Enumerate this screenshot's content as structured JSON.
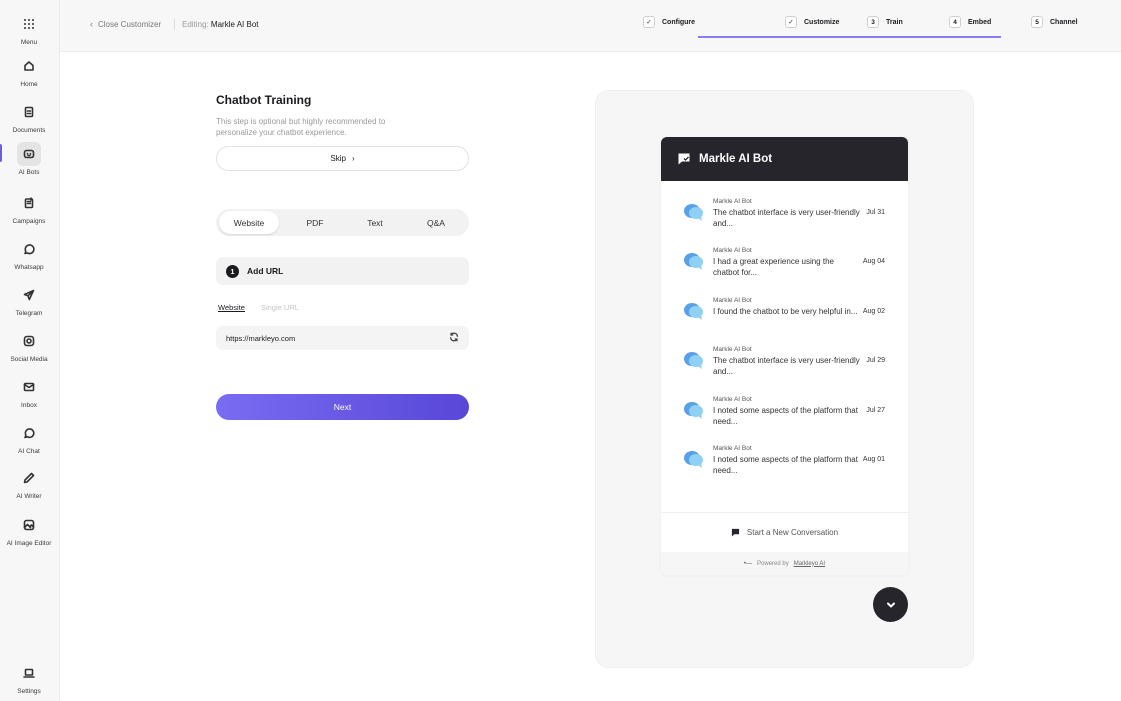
{
  "sidebar": {
    "items": [
      {
        "label": "Menu",
        "icon": "grid-icon"
      },
      {
        "label": "Home",
        "icon": "home-icon"
      },
      {
        "label": "Documents",
        "icon": "document-icon"
      },
      {
        "label": "AI Bots",
        "icon": "bot-icon"
      },
      {
        "label": "Campaigns",
        "icon": "campaign-icon"
      },
      {
        "label": "Whatsapp",
        "icon": "whatsapp-icon"
      },
      {
        "label": "Telegram",
        "icon": "telegram-icon"
      },
      {
        "label": "Social Media",
        "icon": "instagram-icon"
      },
      {
        "label": "Inbox",
        "icon": "mail-icon"
      },
      {
        "label": "AI Chat",
        "icon": "chat-icon"
      },
      {
        "label": "AI Writer",
        "icon": "pen-icon"
      },
      {
        "label": "AI Image Editor",
        "icon": "image-icon"
      },
      {
        "label": "Settings",
        "icon": "laptop-icon"
      }
    ],
    "active": "AI Bots"
  },
  "header": {
    "close_label": "Close Customizer",
    "editing_prefix": "Editing:",
    "editing_name": "Markle AI Bot",
    "steps": [
      {
        "marker": "✓",
        "label": "Configure",
        "done": true
      },
      {
        "marker": "✓",
        "label": "Customize",
        "done": true
      },
      {
        "marker": "3",
        "label": "Train",
        "done": false
      },
      {
        "marker": "4",
        "label": "Embed",
        "done": false
      },
      {
        "marker": "5",
        "label": "Channel",
        "done": false
      }
    ]
  },
  "form": {
    "title": "Chatbot Training",
    "description": "This step is optional but highly recommended to personalize your chatbot experience.",
    "skip_label": "Skip",
    "tabs": [
      "Website",
      "PDF",
      "Text",
      "Q&A"
    ],
    "active_tab": "Website",
    "step_number": "1",
    "step_label": "Add URL",
    "subtab_active": "Website",
    "subtab_inactive": "Single URL",
    "url_value": "https://markleyo.com",
    "next_label": "Next"
  },
  "preview": {
    "bot_name": "Markle AI Bot",
    "messages": [
      {
        "from": "Markle AI Bot",
        "text": "The chatbot interface is very user-friendly and...",
        "date": "Jul 31"
      },
      {
        "from": "Markle AI Bot",
        "text": "I had a great experience using the chatbot for...",
        "date": "Aug 04"
      },
      {
        "from": "Markle AI Bot",
        "text": "I found the chatbot to be very helpful in...",
        "date": "Aug 02"
      },
      {
        "from": "Markle AI Bot",
        "text": "The chatbot interface is very user-friendly and...",
        "date": "Jul 29"
      },
      {
        "from": "Markle AI Bot",
        "text": "I noted some aspects of the platform that need...",
        "date": "Jul 27"
      },
      {
        "from": "Markle AI Bot",
        "text": "I noted some aspects of the platform that need...",
        "date": "Aug 01"
      }
    ],
    "new_conversation_label": "Start a New Conversation",
    "powered_prefix": "Powered by",
    "powered_link": "Markleyo AI"
  },
  "colors": {
    "accent": "#6b5ce7",
    "button_gradient_start": "#7a6cf2",
    "button_gradient_end": "#5847d8",
    "widget_header": "#25252b"
  }
}
